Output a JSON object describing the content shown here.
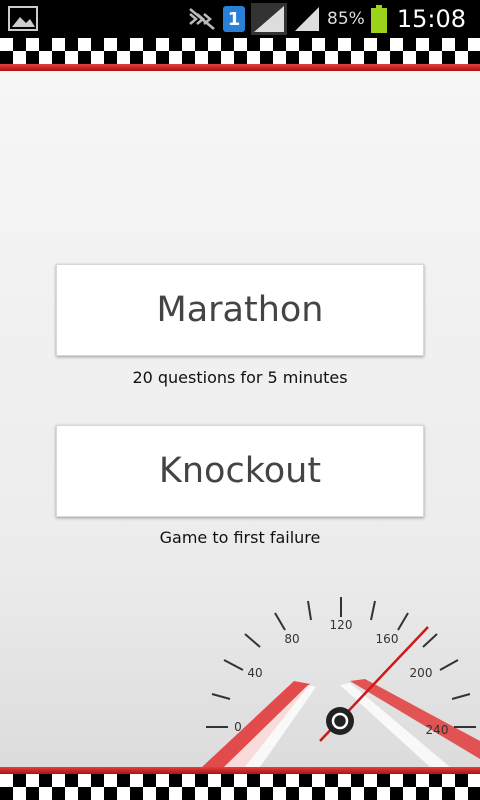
{
  "status_bar": {
    "battery_percent": "85%",
    "time": "15:08",
    "sim_slot": "1",
    "icons": [
      "gallery-icon",
      "mute-icon",
      "sim-icon",
      "signal-icon",
      "signal-icon",
      "battery-icon"
    ]
  },
  "modes": [
    {
      "label": "Marathon",
      "caption": "20 questions for 5 minutes"
    },
    {
      "label": "Knockout",
      "caption": "Game to first failure"
    }
  ],
  "speedometer": {
    "ticks": [
      "0",
      "40",
      "80",
      "120",
      "160",
      "200",
      "240"
    ]
  },
  "colors": {
    "accent_red": "#d01818",
    "button_bg": "#ffffff",
    "button_text": "#444444"
  }
}
